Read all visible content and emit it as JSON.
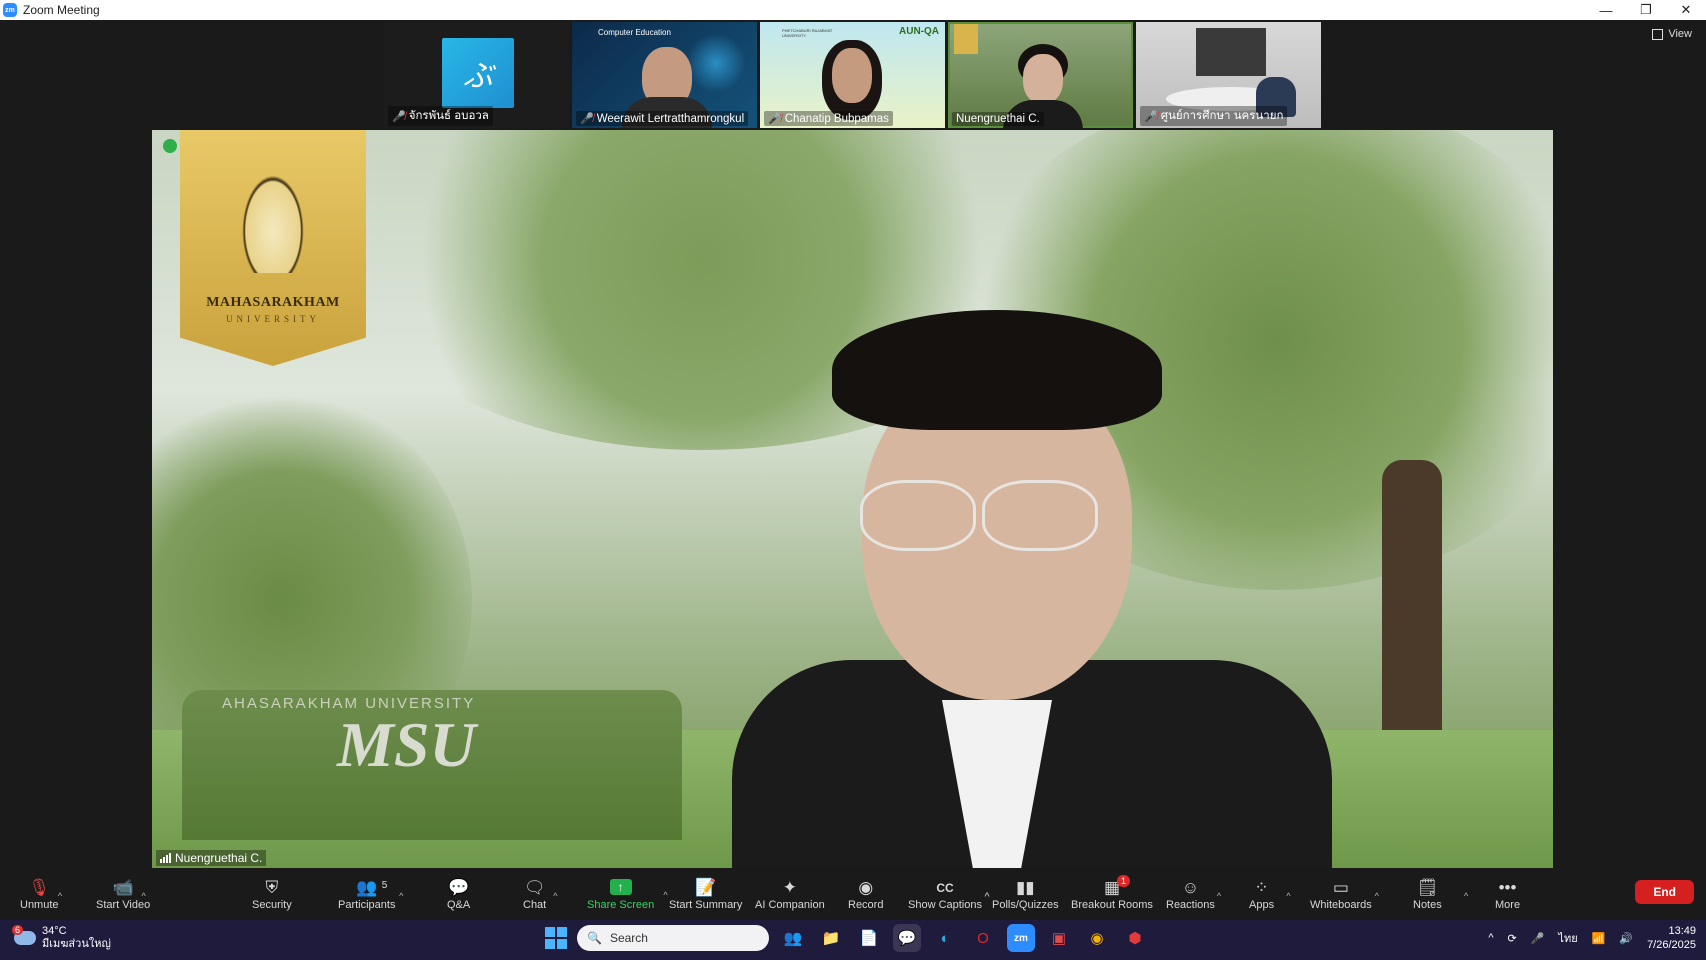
{
  "window": {
    "title": "Zoom Meeting",
    "logo_text": "zm",
    "minimize": "—",
    "restore": "❐",
    "close": "✕"
  },
  "view_button": {
    "label": "View"
  },
  "participants_strip": [
    {
      "name": "จักรพันธ์ อบอวล",
      "muted": true
    },
    {
      "name": "Weerawit Lertratthamrongkul",
      "muted": true
    },
    {
      "name": "Chanatip Bubpamas",
      "muted": true
    },
    {
      "name": "Nuengruethai C.",
      "muted": false
    },
    {
      "name": "ศูนย์การศึกษา นครนายก",
      "muted": true
    }
  ],
  "thumb_text": {
    "comp_ed": "Computer Education",
    "aun_qa": "AUN-QA",
    "pbru": "PHETCHABURI RAJABHAT UNIVERSITY"
  },
  "main_video": {
    "speaker_name": "Nuengruethai C.",
    "banner_title": "MAHASARAKHAM",
    "banner_sub": "UNIVERSITY",
    "sign_top": "AHASARAKHAM UNIVERSITY",
    "sign_text": "MSU"
  },
  "toolbar": {
    "unmute": "Unmute",
    "start_video": "Start Video",
    "security": "Security",
    "participants": "Participants",
    "participants_count": "5",
    "qa": "Q&A",
    "chat": "Chat",
    "share_screen": "Share Screen",
    "start_summary": "Start Summary",
    "ai_companion": "AI Companion",
    "record": "Record",
    "show_captions": "Show Captions",
    "polls": "Polls/Quizzes",
    "breakout": "Breakout Rooms",
    "breakout_badge": "1",
    "reactions": "Reactions",
    "apps": "Apps",
    "whiteboards": "Whiteboards",
    "notes": "Notes",
    "more": "More",
    "end": "End"
  },
  "taskbar": {
    "weather_badge": "6",
    "temperature": "34°C",
    "weather_text": "มีเมฆส่วนใหญ่",
    "search_placeholder": "Search",
    "language": "ไทย",
    "time": "13:49",
    "date": "7/26/2025"
  },
  "colors": {
    "accent_green": "#22b14c",
    "end_red": "#d61f1f",
    "zoom_blue": "#2d8cff",
    "taskbar_bg": "#1f1b3d"
  }
}
